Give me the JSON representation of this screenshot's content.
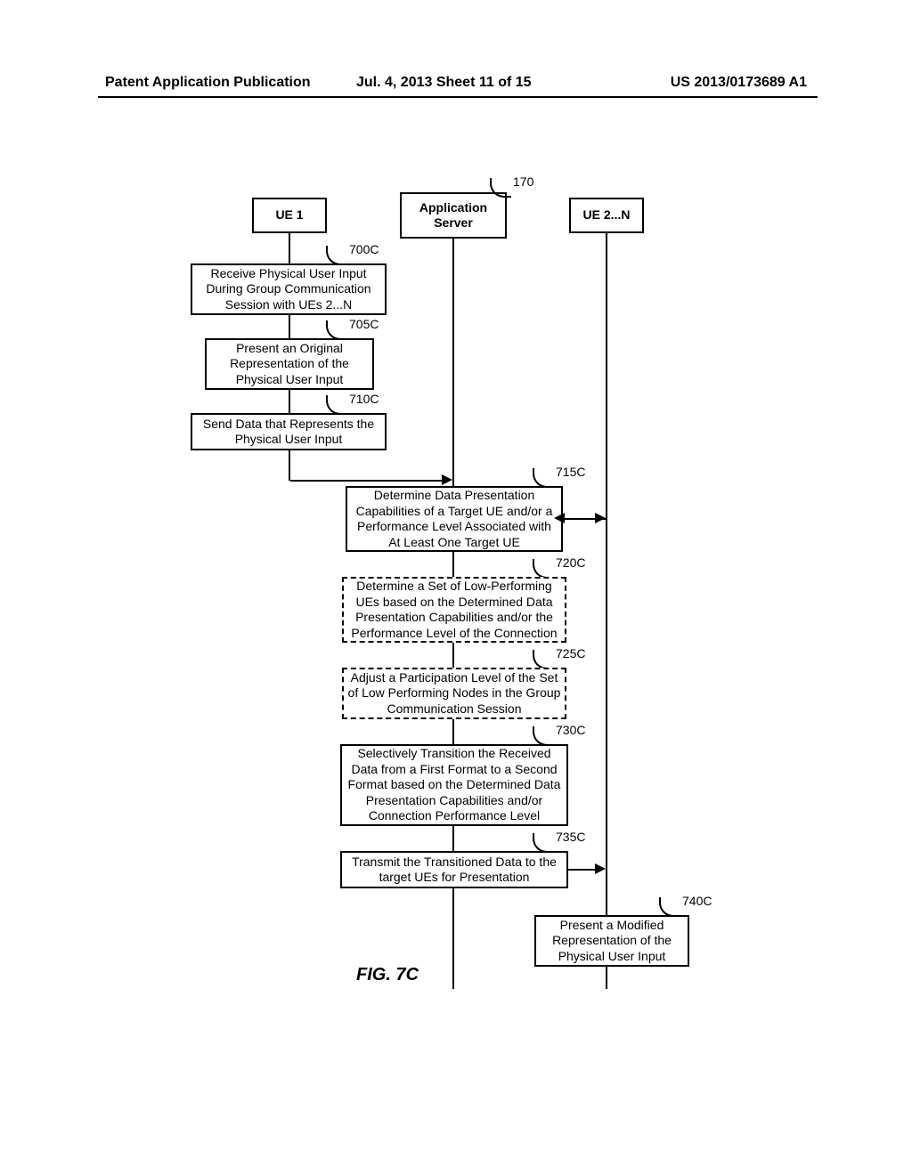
{
  "header": {
    "left": "Patent Application Publication",
    "center": "Jul. 4, 2013   Sheet 11 of 15",
    "right": "US 2013/0173689 A1"
  },
  "lanes": {
    "ue1": "UE 1",
    "server": "Application Server",
    "ue2n": "UE 2...N"
  },
  "server_ref": "170",
  "steps": {
    "s700C": {
      "ref": "700C",
      "text": "Receive Physical User Input During Group Communication Session with UEs 2...N"
    },
    "s705C": {
      "ref": "705C",
      "text": "Present an Original Representation of the Physical User Input"
    },
    "s710C": {
      "ref": "710C",
      "text": "Send Data that Represents the Physical User Input"
    },
    "s715C": {
      "ref": "715C",
      "text": "Determine Data Presentation Capabilities of a Target UE and/or a Performance Level Associated with At Least One Target UE"
    },
    "s720C": {
      "ref": "720C",
      "text": "Determine a Set of Low-Performing UEs based on the Determined Data Presentation Capabilities and/or the Performance Level of the Connection"
    },
    "s725C": {
      "ref": "725C",
      "text": "Adjust a Participation Level of the Set of Low Performing Nodes in the Group Communication Session"
    },
    "s730C": {
      "ref": "730C",
      "text": "Selectively Transition the Received Data from a First Format to a Second Format based on the Determined Data Presentation Capabilities and/or Connection Performance Level"
    },
    "s735C": {
      "ref": "735C",
      "text": "Transmit the Transitioned Data to the target UEs for Presentation"
    },
    "s740C": {
      "ref": "740C",
      "text": "Present a Modified Representation of the Physical User Input"
    }
  },
  "figure_title": "FIG. 7C"
}
